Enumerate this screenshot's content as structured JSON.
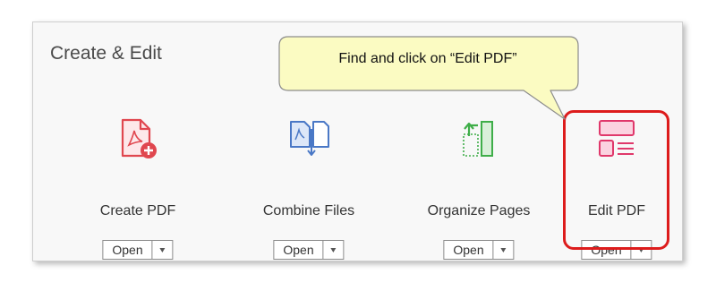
{
  "panel": {
    "title": "Create & Edit"
  },
  "callout": {
    "text": "Find and click on “Edit PDF”"
  },
  "tools": [
    {
      "label": "Create PDF",
      "open_label": "Open",
      "icon": "create-pdf-icon"
    },
    {
      "label": "Combine Files",
      "open_label": "Open",
      "icon": "combine-files-icon"
    },
    {
      "label": "Organize Pages",
      "open_label": "Open",
      "icon": "organize-pages-icon"
    },
    {
      "label": "Edit PDF",
      "open_label": "Open",
      "icon": "edit-pdf-icon"
    }
  ],
  "colors": {
    "highlight": "#dd1c1c",
    "callout_fill": "#fbfbc2",
    "create_pdf": "#e0474f",
    "combine_files": "#4a78c6",
    "organize_pages": "#3fae49",
    "edit_pdf": "#e0386b"
  }
}
